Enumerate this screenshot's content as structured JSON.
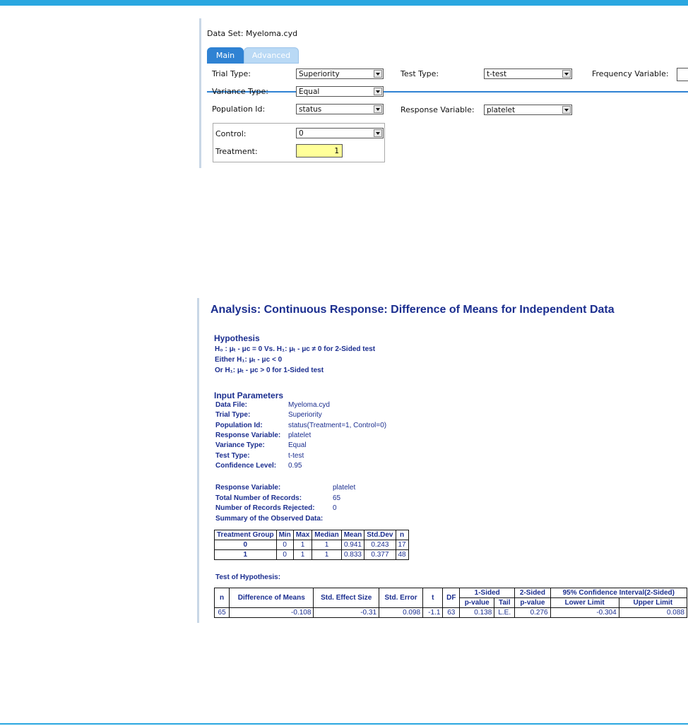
{
  "dialog": {
    "dataset_label": "Data Set: Myeloma.cyd",
    "tabs": [
      {
        "label": "Main",
        "active": true
      },
      {
        "label": "Advanced",
        "active": false
      }
    ],
    "fields": {
      "trial_type": {
        "label": "Trial Type:",
        "value": "Superiority"
      },
      "variance_type": {
        "label": "Variance Type:",
        "value": "Equal"
      },
      "population_id": {
        "label": "Population Id:",
        "value": "status"
      },
      "test_type": {
        "label": "Test Type:",
        "value": "t-test"
      },
      "response_variable": {
        "label": "Response Variable:",
        "value": "platelet"
      },
      "frequency_variable": {
        "label": "Frequency Variable:",
        "value": ""
      },
      "control": {
        "label": "Control:",
        "value": "0"
      },
      "treatment": {
        "label": "Treatment:",
        "value": "1"
      }
    }
  },
  "report": {
    "title": "Analysis: Continuous Response: Difference of Means for Independent Data",
    "hypothesis_heading": "Hypothesis",
    "hypothesis_lines": [
      "H₀ : μₜ - μc = 0 Vs. H₁: μₜ - μc ≠ 0 for 2-Sided test",
      "Either H₁: μₜ - μc < 0",
      "Or H₁: μₜ - μc > 0 for 1-Sided test"
    ],
    "input_heading": "Input Parameters",
    "inputs": [
      {
        "k": "Data File:",
        "v": "Myeloma.cyd"
      },
      {
        "k": "Trial Type:",
        "v": "Superiority"
      },
      {
        "k": "Population Id:",
        "v": "status(Treatment=1, Control=0)"
      },
      {
        "k": "Response Variable:",
        "v": "platelet"
      },
      {
        "k": "Variance Type:",
        "v": "Equal"
      },
      {
        "k": "Test Type:",
        "v": "t-test"
      },
      {
        "k": "Confidence Level:",
        "v": "0.95"
      }
    ],
    "summary": [
      {
        "k": "Response Variable:",
        "v": "platelet"
      },
      {
        "k": "Total Number of Records:",
        "v": "65"
      },
      {
        "k": "Number of Records Rejected:",
        "v": "0"
      },
      {
        "k": "Summary of the Observed Data:",
        "v": ""
      }
    ],
    "observed": {
      "headers": [
        "Treatment Group",
        "Min",
        "Max",
        "Median",
        "Mean",
        "Std.Dev",
        "n"
      ],
      "rows": [
        [
          "0",
          "0",
          "1",
          "1",
          "0.941",
          "0.243",
          "17"
        ],
        [
          "1",
          "0",
          "1",
          "1",
          "0.833",
          "0.377",
          "48"
        ]
      ]
    },
    "test_heading": "Test of Hypothesis:",
    "test": {
      "top_headers": [
        "n",
        "Difference of Means",
        "Std. Effect Size",
        "Std. Error",
        "t",
        "DF",
        "1-Sided",
        "2-Sided",
        "95% Confidence Interval(2-Sided)"
      ],
      "sub_headers": [
        "p-value",
        "Tail",
        "p-value",
        "Lower Limit",
        "Upper Limit"
      ],
      "row": [
        "65",
        "-0.108",
        "-0.31",
        "0.098",
        "-1.1",
        "63",
        "0.138",
        "L.E.",
        "0.276",
        "-0.304",
        "0.088"
      ]
    }
  }
}
